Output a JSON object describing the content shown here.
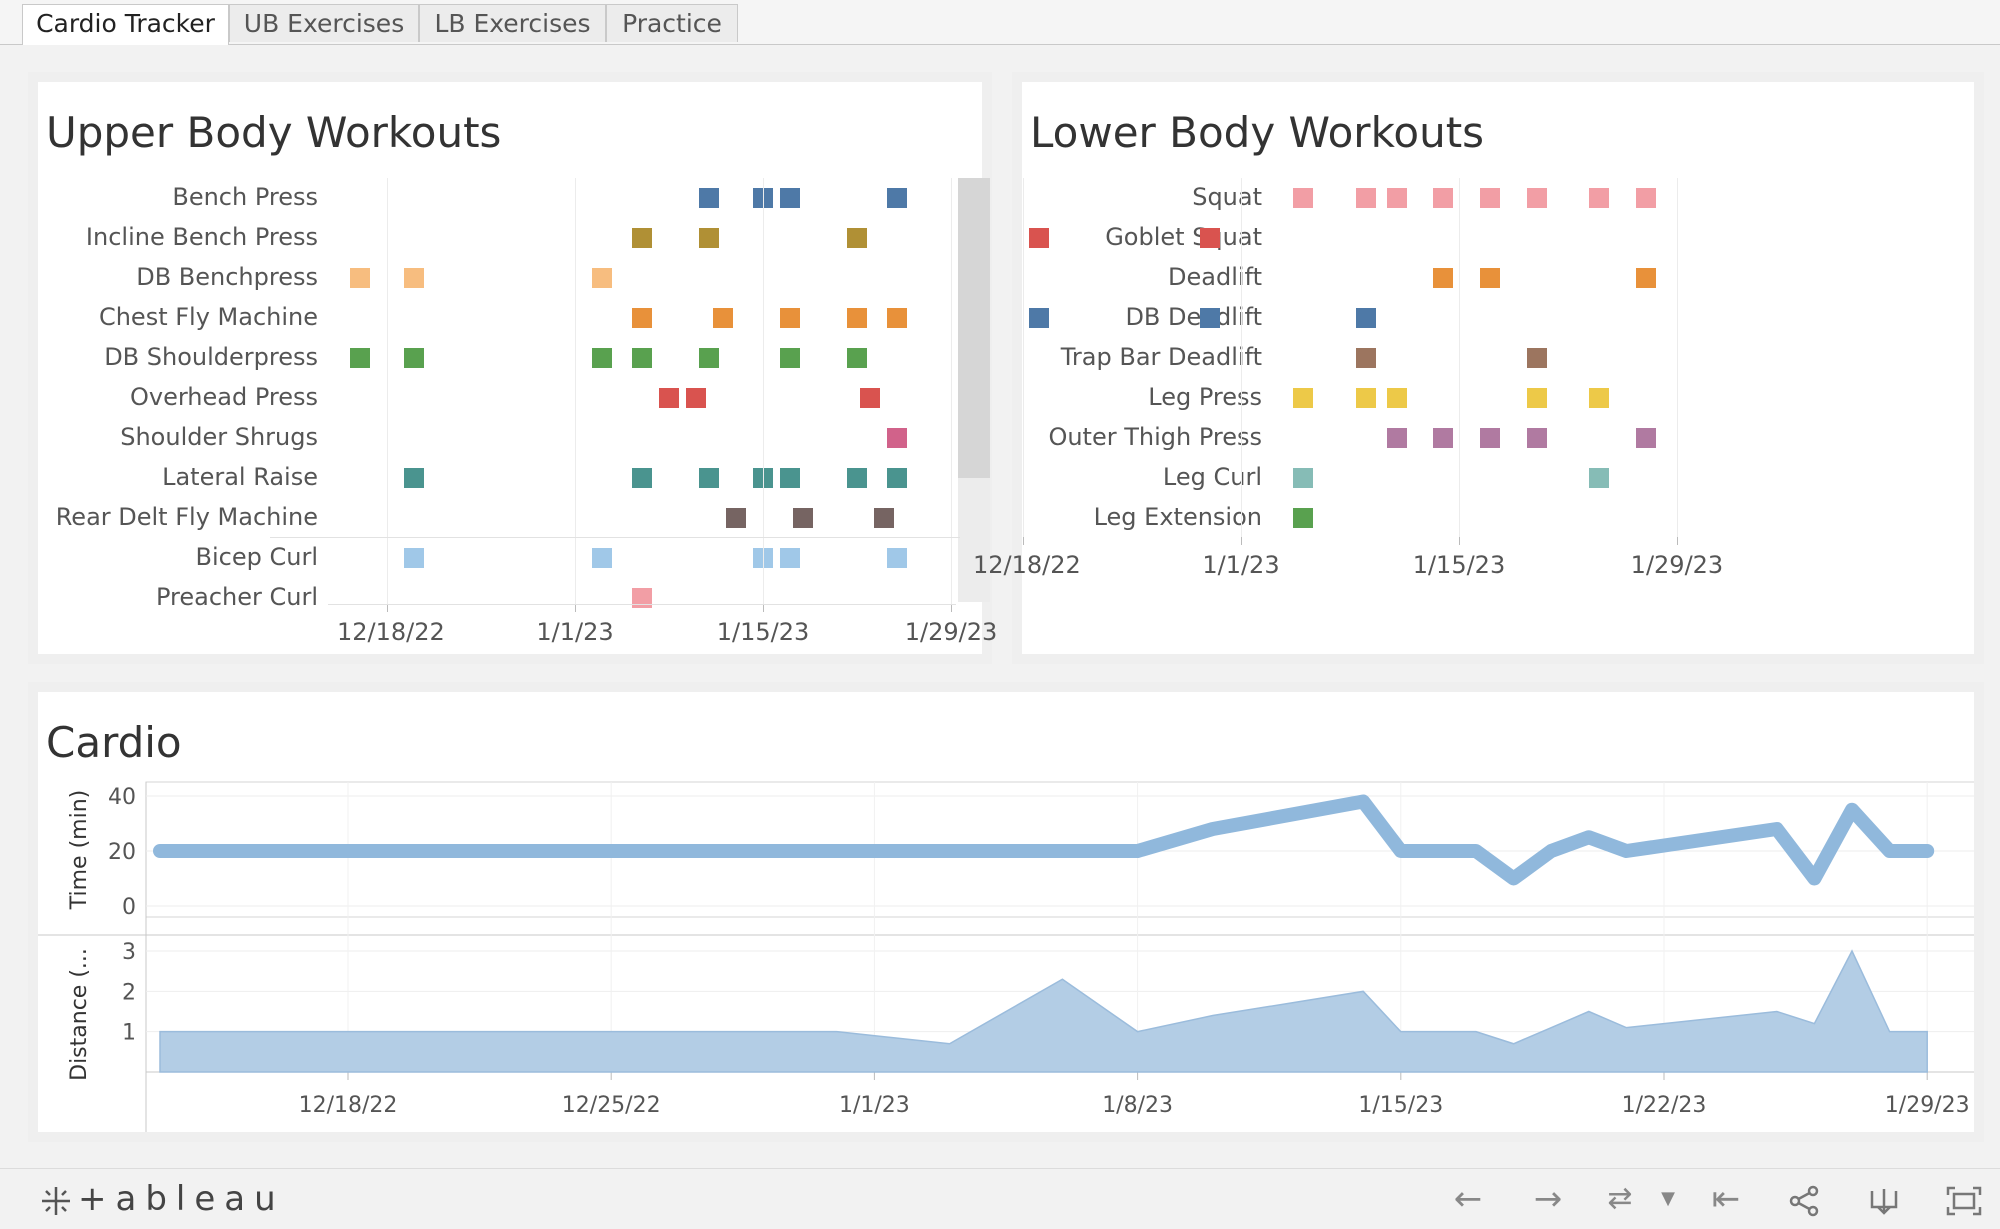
{
  "tabs": [
    "Cardio Tracker",
    "UB Exercises",
    "LB Exercises",
    "Practice"
  ],
  "upper": {
    "title": "Upper Body Workouts",
    "rows": [
      "Bench Press",
      "Incline Bench Press",
      "DB Benchpress",
      "Chest Fly Machine",
      "DB Shoulderpress",
      "Overhead Press",
      "Shoulder Shrugs",
      "Lateral Raise",
      "Rear Delt Fly Machine",
      "Bicep Curl",
      "Preacher Curl"
    ],
    "x_ticks": [
      "12/18/22",
      "1/1/23",
      "1/15/23",
      "1/29/23"
    ]
  },
  "lower": {
    "title": "Lower Body Workouts",
    "rows": [
      "Squat",
      "Goblet Squat",
      "Deadlift",
      "DB Deadlift",
      "Trap Bar Deadlift",
      "Leg Press",
      "Outer Thigh Press",
      "Leg Curl",
      "Leg Extension"
    ],
    "x_ticks": [
      "12/18/22",
      "1/1/23",
      "1/15/23",
      "1/29/23"
    ]
  },
  "cardio": {
    "title": "Cardio",
    "time_axis_label": "Time (min)",
    "time_ticks": [
      "40",
      "20",
      "0"
    ],
    "distance_axis_label": "Distance (...",
    "distance_ticks": [
      "3",
      "2",
      "1"
    ],
    "x_ticks": [
      "12/18/22",
      "12/25/22",
      "1/1/23",
      "1/8/23",
      "1/15/23",
      "1/22/23",
      "1/29/23"
    ]
  },
  "chart_data": [
    {
      "type": "scatter",
      "title": "Upper Body Workouts",
      "x_axis": "date",
      "categories": [
        "Bench Press",
        "Incline Bench Press",
        "DB Benchpress",
        "Chest Fly Machine",
        "DB Shoulderpress",
        "Overhead Press",
        "Shoulder Shrugs",
        "Lateral Raise",
        "Rear Delt Fly Machine",
        "Bicep Curl",
        "Preacher Curl"
      ],
      "series": [
        {
          "row": "Bench Press",
          "color": "#4e79a7",
          "dates": [
            "2023-01-11",
            "2023-01-15",
            "2023-01-17",
            "2023-01-25"
          ]
        },
        {
          "row": "Incline Bench Press",
          "color": "#b09035",
          "dates": [
            "2023-01-06",
            "2023-01-11",
            "2023-01-22"
          ]
        },
        {
          "row": "DB Benchpress",
          "color": "#f7bd7f",
          "dates": [
            "2022-12-16",
            "2022-12-20",
            "2023-01-03"
          ]
        },
        {
          "row": "Chest Fly Machine",
          "color": "#e8913a",
          "dates": [
            "2023-01-06",
            "2023-01-12",
            "2023-01-17",
            "2023-01-22",
            "2023-01-25"
          ]
        },
        {
          "row": "DB Shoulderpress",
          "color": "#59a14f",
          "dates": [
            "2022-12-16",
            "2022-12-20",
            "2023-01-03",
            "2023-01-06",
            "2023-01-11",
            "2023-01-17",
            "2023-01-22"
          ]
        },
        {
          "row": "Overhead Press",
          "color": "#d9534f",
          "dates": [
            "2023-01-08",
            "2023-01-10",
            "2023-01-23"
          ]
        },
        {
          "row": "Shoulder Shrugs",
          "color": "#d1628a",
          "dates": [
            "2023-01-25"
          ]
        },
        {
          "row": "Lateral Raise",
          "color": "#4a948f",
          "dates": [
            "2022-12-20",
            "2023-01-06",
            "2023-01-11",
            "2023-01-15",
            "2023-01-17",
            "2023-01-22",
            "2023-01-25"
          ]
        },
        {
          "row": "Rear Delt Fly Machine",
          "color": "#766462",
          "dates": [
            "2023-01-13",
            "2023-01-18",
            "2023-01-24"
          ]
        },
        {
          "row": "Bicep Curl",
          "color": "#a0c8e8",
          "dates": [
            "2022-12-20",
            "2023-01-03",
            "2023-01-15",
            "2023-01-17",
            "2023-01-25"
          ]
        },
        {
          "row": "Preacher Curl",
          "color": "#f29ea5",
          "dates": [
            "2023-01-06"
          ]
        }
      ]
    },
    {
      "type": "scatter",
      "title": "Lower Body Workouts",
      "x_axis": "date",
      "categories": [
        "Squat",
        "Goblet Squat",
        "Deadlift",
        "DB Deadlift",
        "Trap Bar Deadlift",
        "Leg Press",
        "Outer Thigh Press",
        "Leg Curl",
        "Leg Extension"
      ],
      "series": [
        {
          "row": "Squat",
          "color": "#f29ea5",
          "dates": [
            "2023-01-05",
            "2023-01-09",
            "2023-01-11",
            "2023-01-14",
            "2023-01-17",
            "2023-01-20",
            "2023-01-24",
            "2023-01-27"
          ]
        },
        {
          "row": "Goblet Squat",
          "color": "#d9534f",
          "dates": [
            "2022-12-19",
            "2022-12-30"
          ]
        },
        {
          "row": "Deadlift",
          "color": "#e8913a",
          "dates": [
            "2023-01-14",
            "2023-01-17",
            "2023-01-27"
          ]
        },
        {
          "row": "DB Deadlift",
          "color": "#4e79a7",
          "dates": [
            "2022-12-19",
            "2022-12-30",
            "2023-01-09"
          ]
        },
        {
          "row": "Trap Bar Deadlift",
          "color": "#9c755f",
          "dates": [
            "2023-01-09",
            "2023-01-20"
          ]
        },
        {
          "row": "Leg Press",
          "color": "#edc948",
          "dates": [
            "2023-01-05",
            "2023-01-09",
            "2023-01-11",
            "2023-01-20",
            "2023-01-24"
          ]
        },
        {
          "row": "Outer Thigh Press",
          "color": "#b07aa1",
          "dates": [
            "2023-01-11",
            "2023-01-14",
            "2023-01-17",
            "2023-01-20",
            "2023-01-27"
          ]
        },
        {
          "row": "Leg Curl",
          "color": "#86bcb6",
          "dates": [
            "2023-01-05",
            "2023-01-24"
          ]
        },
        {
          "row": "Leg Extension",
          "color": "#59a14f",
          "dates": [
            "2023-01-05"
          ]
        }
      ]
    },
    {
      "type": "line",
      "title": "Cardio",
      "ylabel": "Time (min)",
      "ylim": [
        0,
        40
      ],
      "color": "#90b8dc",
      "x": [
        "2022-12-13",
        "2022-12-17",
        "2022-12-21",
        "2022-12-25",
        "2022-12-29",
        "2023-01-02",
        "2023-01-04",
        "2023-01-06",
        "2023-01-08",
        "2023-01-10",
        "2023-01-14",
        "2023-01-15",
        "2023-01-17",
        "2023-01-18",
        "2023-01-19",
        "2023-01-20",
        "2023-01-21",
        "2023-01-25",
        "2023-01-26",
        "2023-01-27",
        "2023-01-28",
        "2023-01-29"
      ],
      "y": [
        20,
        20,
        20,
        20,
        20,
        20,
        20,
        20,
        20,
        28,
        38,
        20,
        20,
        10,
        20,
        25,
        20,
        28,
        10,
        35,
        20,
        20
      ]
    },
    {
      "type": "area",
      "ylabel": "Distance (...",
      "ylim": [
        0,
        3
      ],
      "color": "#b3cde5",
      "x": [
        "2022-12-13",
        "2022-12-16",
        "2022-12-17",
        "2022-12-21",
        "2022-12-26",
        "2022-12-31",
        "2023-01-03",
        "2023-01-06",
        "2023-01-08",
        "2023-01-10",
        "2023-01-14",
        "2023-01-15",
        "2023-01-17",
        "2023-01-18",
        "2023-01-19",
        "2023-01-20",
        "2023-01-21",
        "2023-01-25",
        "2023-01-26",
        "2023-01-27",
        "2023-01-28",
        "2023-01-29"
      ],
      "y": [
        1,
        1,
        1,
        1,
        1,
        1,
        0.7,
        2.3,
        1,
        1.4,
        2,
        1,
        1,
        0.7,
        1.1,
        1.5,
        1.1,
        1.5,
        1.2,
        3,
        1,
        1
      ]
    }
  ],
  "toolbar": {
    "logo": "+ableau",
    "icons": [
      "undo-arrow",
      "redo-arrow",
      "revert",
      "revert-dropdown",
      "reset-start",
      "share",
      "download",
      "fullscreen"
    ]
  }
}
